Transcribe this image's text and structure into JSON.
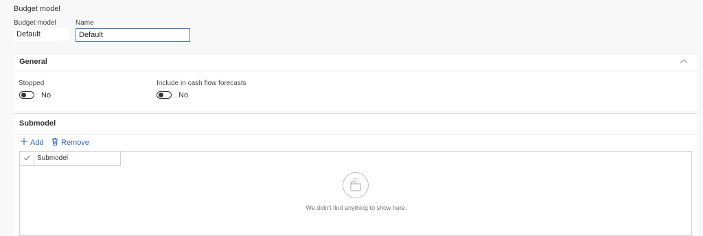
{
  "header": {
    "title": "Budget model",
    "model_label": "Budget model",
    "model_value": "Default",
    "name_label": "Name",
    "name_value": "Default"
  },
  "general": {
    "title": "General",
    "stopped_label": "Stopped",
    "stopped_value": "No",
    "cashflow_label": "Include in cash flow forecasts",
    "cashflow_value": "No"
  },
  "submodel": {
    "title": "Submodel",
    "add_label": "Add",
    "remove_label": "Remove",
    "column_header": "Submodel",
    "empty_message": "We didn't find anything to show here."
  },
  "icons": {
    "add": "plus-icon",
    "remove": "trash-icon",
    "collapse": "chevron-up-icon",
    "select_all": "check-icon",
    "empty": "empty-folder-icon"
  },
  "colors": {
    "accent": "#2c62c9",
    "focus_border": "#4a78c7"
  }
}
